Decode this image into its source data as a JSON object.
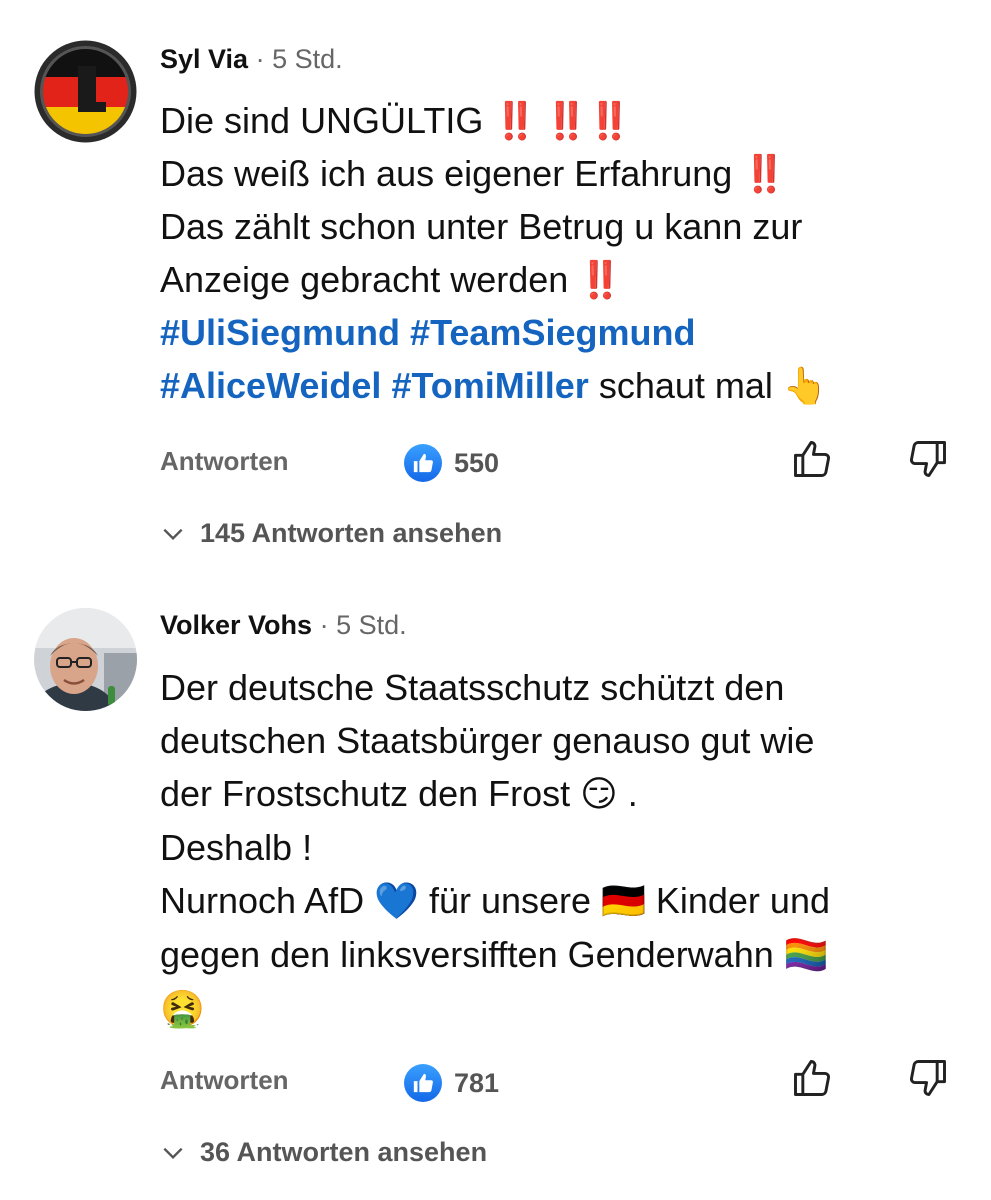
{
  "comments": [
    {
      "author": "Syl Via",
      "time": "5 Std.",
      "lines": [
        [
          {
            "t": "Die sind UNGÜLTIG "
          },
          {
            "t": "‼️ ‼️‼️",
            "k": "bang"
          }
        ],
        [
          {
            "t": "Das weiß ich aus eigener Erfahrung "
          },
          {
            "t": "‼️",
            "k": "bang"
          }
        ],
        [
          {
            "t": "Das zählt schon unter Betrug u kann zur"
          }
        ],
        [
          {
            "t": "Anzeige gebracht werden "
          },
          {
            "t": "‼️",
            "k": "bang"
          }
        ],
        [
          {
            "t": "#UliSiegmund",
            "k": "tag"
          },
          {
            "t": " "
          },
          {
            "t": "#TeamSiegmund",
            "k": "tag"
          }
        ],
        [
          {
            "t": "#AliceWeidel",
            "k": "tag"
          },
          {
            "t": "  "
          },
          {
            "t": "#TomiMiller",
            "k": "tag"
          },
          {
            "t": "  schaut mal "
          },
          {
            "t": "👆",
            "k": "emoji"
          }
        ]
      ],
      "reply_label": "Antworten",
      "likes": "550",
      "view_replies": "145 Antworten ansehen"
    },
    {
      "author": "Volker Vohs",
      "time": "5 Std.",
      "lines": [
        [
          {
            "t": "Der deutsche Staatsschutz schützt den"
          }
        ],
        [
          {
            "t": "deutschen Staatsbürger genauso gut wie"
          }
        ],
        [
          {
            "t": "der  Frostschutz den Frost "
          },
          {
            "t": "😏",
            "k": "emoji"
          },
          {
            "t": " ."
          }
        ],
        [
          {
            "t": "Deshalb !"
          }
        ],
        [
          {
            "t": "Nurnoch AfD "
          },
          {
            "t": "💙",
            "k": "emoji"
          },
          {
            "t": " für unsere "
          },
          {
            "t": "🇩🇪",
            "k": "emoji"
          },
          {
            "t": " Kinder und"
          }
        ],
        [
          {
            "t": "gegen den linksversifften Genderwahn "
          },
          {
            "t": "🏳️‍🌈",
            "k": "emoji"
          }
        ],
        [
          {
            "t": "🤮",
            "k": "emoji"
          }
        ]
      ],
      "reply_label": "Antworten",
      "likes": "781",
      "view_replies": "36 Antworten ansehen"
    }
  ],
  "icons": {
    "like_badge": "thumbs-up-icon",
    "like": "thumb-up-outline-icon",
    "dislike": "thumb-down-outline-icon",
    "expand": "chevron-down-icon"
  },
  "colors": {
    "hashtag": "#1565c0",
    "bang": "#e31b23",
    "like_badge": "#1877f2",
    "meta": "#666666"
  }
}
